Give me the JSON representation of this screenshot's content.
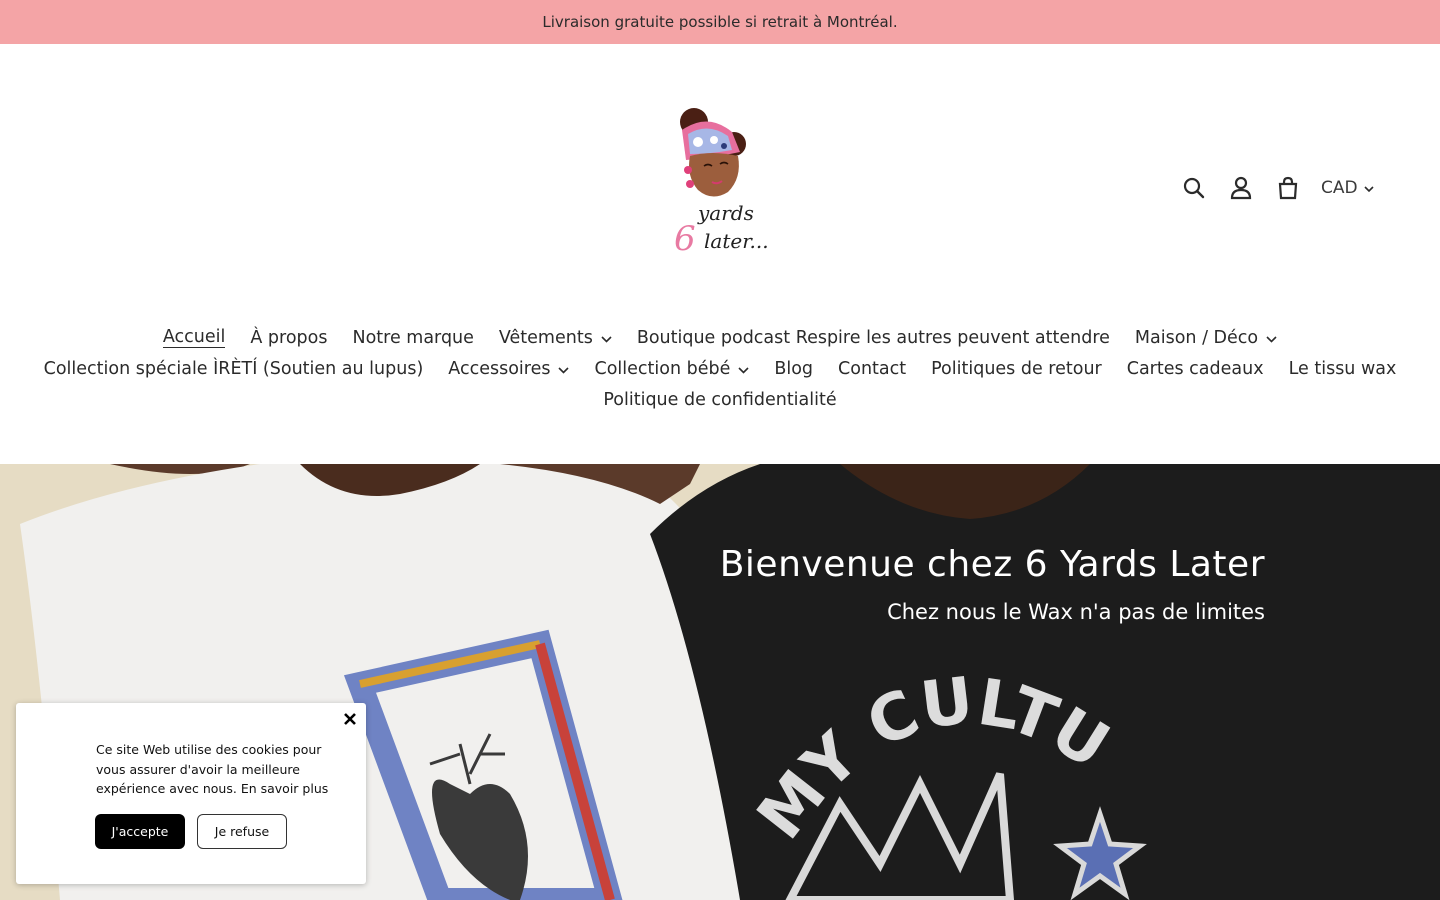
{
  "announcement": {
    "text": "Livraison gratuite possible si retrait à Montréal."
  },
  "logo": {
    "text_line1": "yards",
    "text_line2": "later...",
    "digit": "6"
  },
  "header": {
    "icons": [
      "search-icon",
      "account-icon",
      "cart-icon"
    ],
    "currency": "CAD"
  },
  "nav": {
    "row1": [
      {
        "label": "Accueil",
        "active": true,
        "dropdown": false
      },
      {
        "label": "À propos",
        "dropdown": false
      },
      {
        "label": "Notre marque",
        "dropdown": false
      },
      {
        "label": "Vêtements",
        "dropdown": true
      },
      {
        "label": "Boutique podcast Respire les autres peuvent attendre",
        "dropdown": false
      },
      {
        "label": "Maison / Déco",
        "dropdown": true
      }
    ],
    "row2": [
      {
        "label": "Collection spéciale ÌRÈTÍ (Soutien au lupus)",
        "dropdown": false
      },
      {
        "label": "Accessoires",
        "dropdown": true
      },
      {
        "label": "Collection bébé",
        "dropdown": true
      },
      {
        "label": "Blog",
        "dropdown": false
      },
      {
        "label": "Contact",
        "dropdown": false
      },
      {
        "label": "Politiques de retour",
        "dropdown": false
      },
      {
        "label": "Cartes cadeaux",
        "dropdown": false
      },
      {
        "label": "Le tissu wax",
        "dropdown": false
      }
    ],
    "row3": [
      {
        "label": "Politique de confidentialité",
        "dropdown": false
      }
    ]
  },
  "hero": {
    "title": "Bienvenue chez 6 Yards Later",
    "subtitle": "Chez nous le Wax n'a pas de limites",
    "shirt_text": "MY CULTURE"
  },
  "cookie": {
    "message": "Ce site Web utilise des cookies pour vous assurer d'avoir la meilleure expérience avec nous.",
    "learn_more": "En savoir plus",
    "accept_label": "J'accepte",
    "refuse_label": "Je refuse"
  },
  "colors": {
    "announcement_bg": "#f4a4a6",
    "text": "#2b2b2b"
  }
}
